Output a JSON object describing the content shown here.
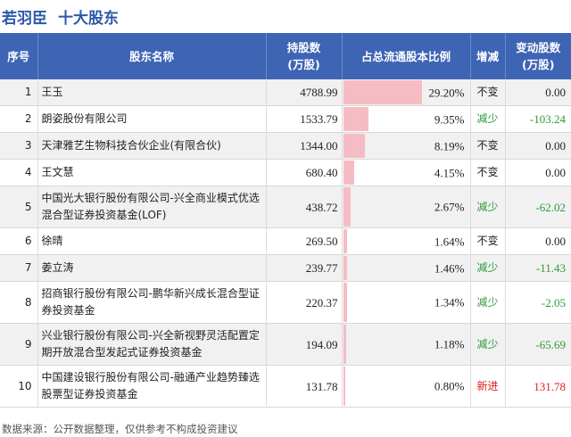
{
  "title": {
    "company": "若羽臣",
    "subtitle": "十大股东"
  },
  "table": {
    "headers": {
      "rank": "序号",
      "name": "股东名称",
      "shares_line1": "持股数",
      "shares_line2": "(万股)",
      "ratio": "占总流通股本比例",
      "change": "增减",
      "delta_line1": "变动股数",
      "delta_line2": "(万股)"
    },
    "rows": [
      {
        "rank": "1",
        "name": "王玉",
        "shares": "4788.99",
        "ratio": "29.20%",
        "ratio_value": 29.2,
        "change": "不变",
        "delta": "0.00",
        "change_type": "same"
      },
      {
        "rank": "2",
        "name": "朗姿股份有限公司",
        "shares": "1533.79",
        "ratio": "9.35%",
        "ratio_value": 9.35,
        "change": "减少",
        "delta": "-103.24",
        "change_type": "down"
      },
      {
        "rank": "3",
        "name": "天津雅艺生物科技合伙企业(有限合伙)",
        "shares": "1344.00",
        "ratio": "8.19%",
        "ratio_value": 8.19,
        "change": "不变",
        "delta": "0.00",
        "change_type": "same"
      },
      {
        "rank": "4",
        "name": "王文慧",
        "shares": "680.40",
        "ratio": "4.15%",
        "ratio_value": 4.15,
        "change": "不变",
        "delta": "0.00",
        "change_type": "same"
      },
      {
        "rank": "5",
        "name": "中国光大银行股份有限公司-兴全商业模式优选混合型证券投资基金(LOF)",
        "shares": "438.72",
        "ratio": "2.67%",
        "ratio_value": 2.67,
        "change": "减少",
        "delta": "-62.02",
        "change_type": "down"
      },
      {
        "rank": "6",
        "name": "徐晴",
        "shares": "269.50",
        "ratio": "1.64%",
        "ratio_value": 1.64,
        "change": "不变",
        "delta": "0.00",
        "change_type": "same"
      },
      {
        "rank": "7",
        "name": "姜立涛",
        "shares": "239.77",
        "ratio": "1.46%",
        "ratio_value": 1.46,
        "change": "减少",
        "delta": "-11.43",
        "change_type": "down"
      },
      {
        "rank": "8",
        "name": "招商银行股份有限公司-鹏华新兴成长混合型证券投资基金",
        "shares": "220.37",
        "ratio": "1.34%",
        "ratio_value": 1.34,
        "change": "减少",
        "delta": "-2.05",
        "change_type": "down"
      },
      {
        "rank": "9",
        "name": "兴业银行股份有限公司-兴全新视野灵活配置定期开放混合型发起式证券投资基金",
        "shares": "194.09",
        "ratio": "1.18%",
        "ratio_value": 1.18,
        "change": "减少",
        "delta": "-65.69",
        "change_type": "down"
      },
      {
        "rank": "10",
        "name": "中国建设银行股份有限公司-融通产业趋势臻选股票型证券投资基金",
        "shares": "131.78",
        "ratio": "0.80%",
        "ratio_value": 0.8,
        "change": "新进",
        "delta": "131.78",
        "change_type": "new"
      }
    ]
  },
  "footer": "数据来源：公开数据整理，仅供参考不构成投资建议",
  "colors": {
    "header_bg": "#3e64b4",
    "title": "#2e57a8",
    "bar": "#f6bcc4",
    "down": "#2e9a3a",
    "new": "#e02020",
    "same": "#222222"
  }
}
